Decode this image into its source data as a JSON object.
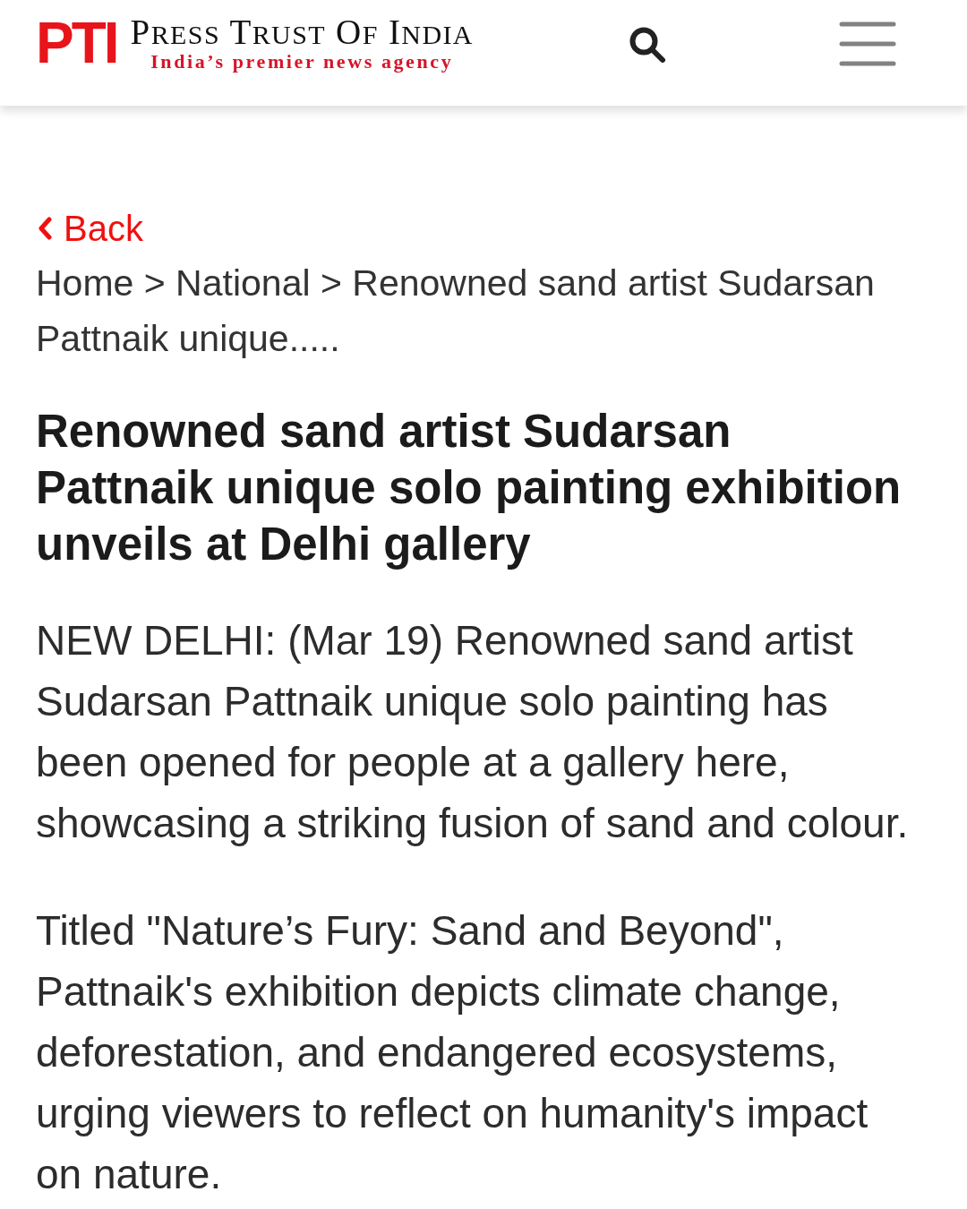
{
  "header": {
    "logo": {
      "mark": "PTI",
      "name": "PRESS TRUST OF INDIA",
      "tagline": "India’s premier news agency"
    }
  },
  "back_link": {
    "label": "Back"
  },
  "breadcrumb": [
    {
      "label": "Home",
      "separator_after": ">"
    },
    {
      "label": "National",
      "separator_after": ">"
    },
    {
      "label": "Renowned sand artist Sudarsan Pattnaik unique....."
    }
  ],
  "article": {
    "title": "Renowned sand artist Sudarsan Pattnaik unique solo painting exhibition unveils at Delhi gallery",
    "paragraphs": [
      "NEW DELHI: (Mar 19) Renowned sand artist Sudarsan Pattnaik unique solo painting has been opened for people at a gallery here, showcasing a striking fusion of sand and colour.",
      "Titled \"Nature’s Fury: Sand and Beyond\", Pattnaik's exhibition depicts climate change, deforestation, and endangered ecosystems, urging viewers to reflect on humanity's impact on nature."
    ]
  }
}
